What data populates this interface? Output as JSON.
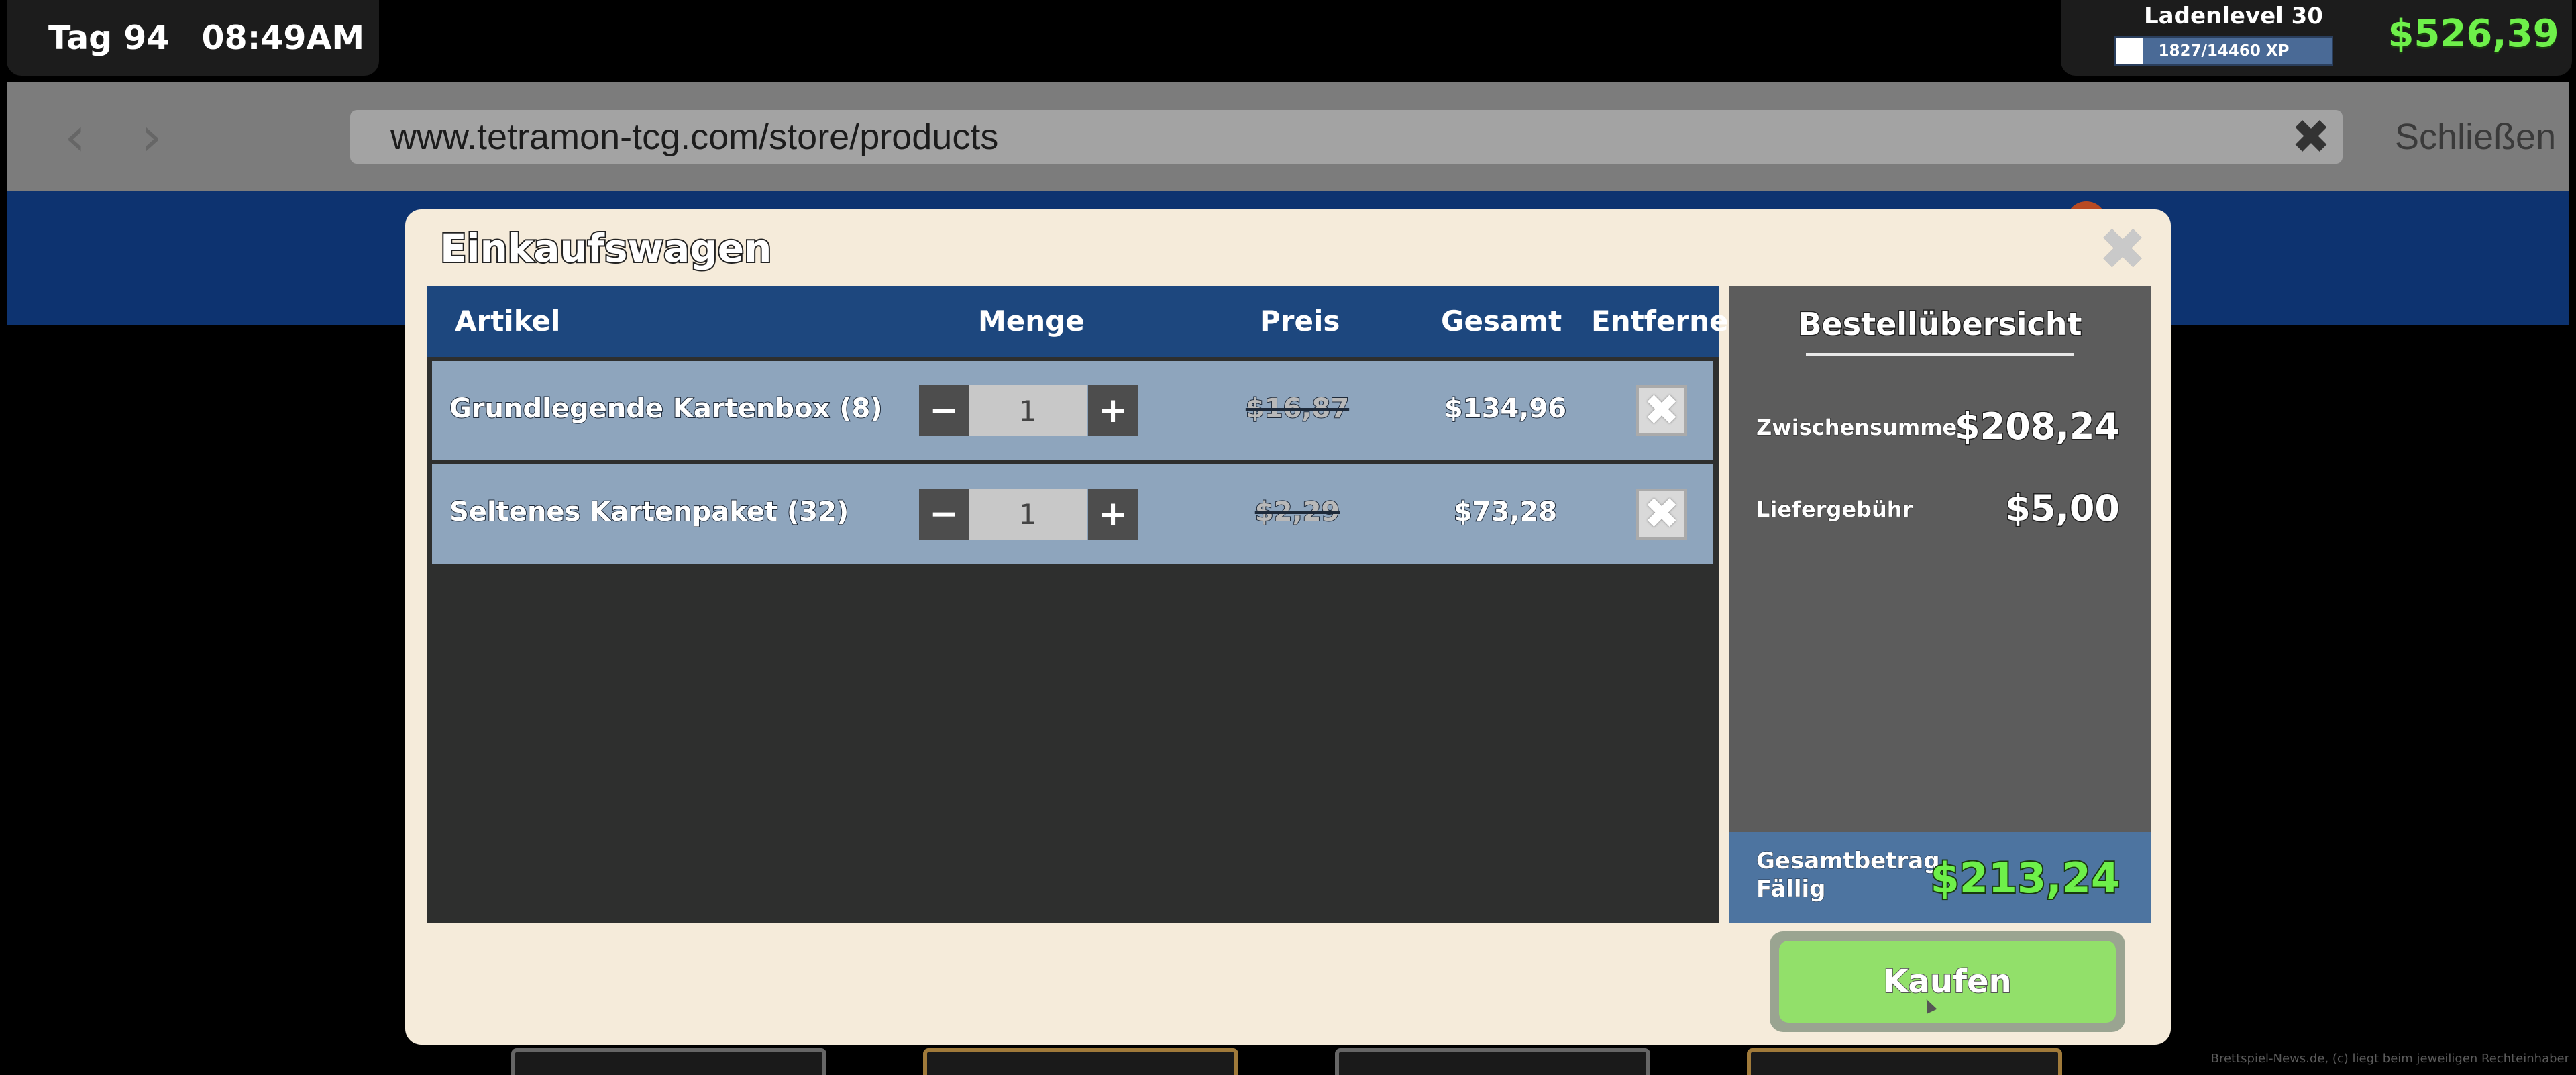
{
  "hud": {
    "day": "Tag 94",
    "time": "08:49AM",
    "level_label": "Ladenlevel 30",
    "xp_text": "1827/14460 XP",
    "xp_fraction": 0.126,
    "money": "$526,39"
  },
  "browser": {
    "url": "www.tetramon-tcg.com/store/products",
    "close_label": "Schließen"
  },
  "cart": {
    "title": "Einkaufswagen",
    "columns": {
      "item": "Artikel",
      "qty": "Menge",
      "price": "Preis",
      "total": "Gesamt",
      "remove": "Entfernen"
    },
    "rows": [
      {
        "name": "Grundlegende Kartenbox (8)",
        "qty": "1",
        "price": "$16,87",
        "total": "$134,96"
      },
      {
        "name": "Seltenes Kartenpaket (32)",
        "qty": "1",
        "price": "$2,29",
        "total": "$73,28"
      }
    ]
  },
  "summary": {
    "title": "Bestellübersicht",
    "subtotal_label": "Zwischensumme",
    "subtotal_value": "$208,24",
    "delivery_label": "Liefergebühr",
    "delivery_value": "$5,00",
    "total_label": "Gesamtbetrag Fällig",
    "total_value": "$213,24"
  },
  "buy_label": "Kaufen",
  "credit": "Brettspiel-News.de, (c) liegt beim jeweiligen Rechteinhaber"
}
